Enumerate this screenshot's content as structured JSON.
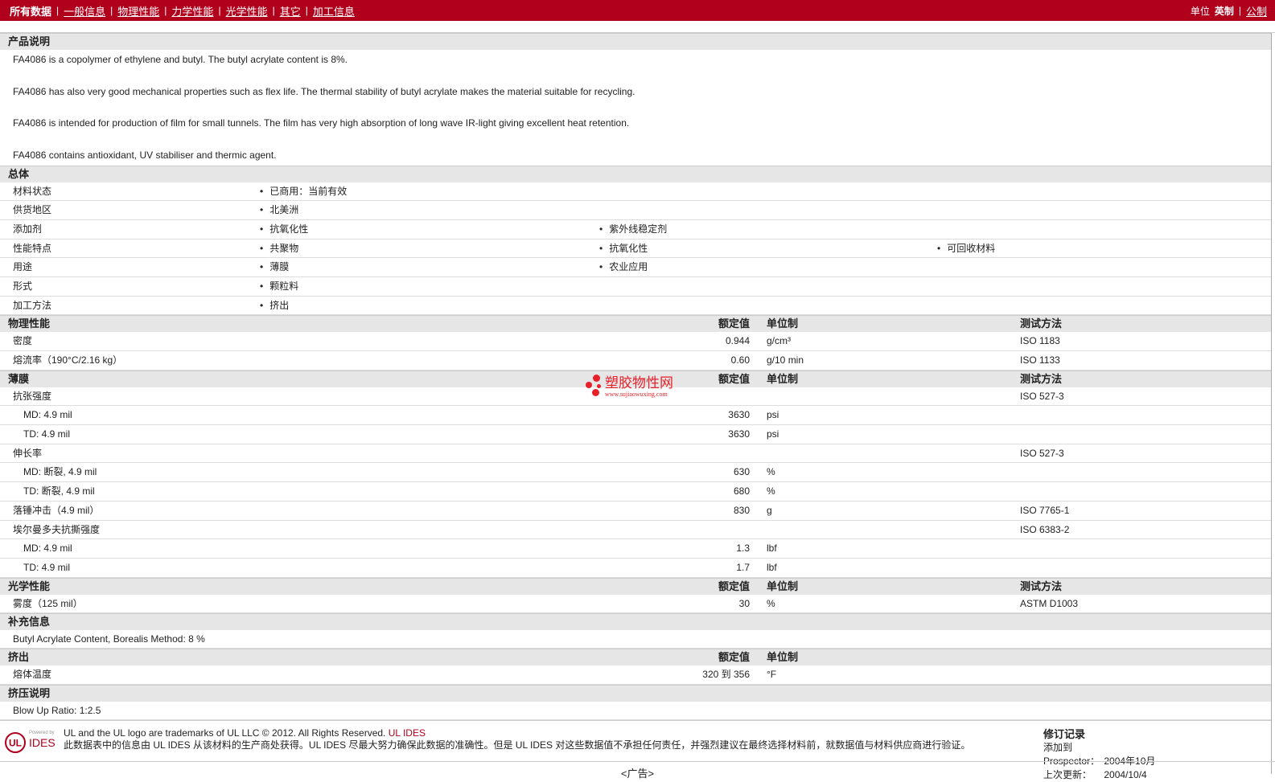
{
  "nav": {
    "items": [
      "所有数据",
      "一般信息",
      "物理性能",
      "力学性能",
      "光学性能",
      "其它",
      "加工信息"
    ],
    "units_label": "单位",
    "unit_english": "英制",
    "unit_metric": "公制"
  },
  "description": {
    "title": "产品说明",
    "paragraphs": [
      "FA4086 is a copolymer of ethylene and butyl. The butyl acrylate content is 8%.",
      "FA4086 has also very good mechanical properties such as flex life. The thermal stability of butyl acrylate makes the material suitable for recycling.",
      "FA4086 is intended for production of film for small tunnels. The film has very high absorption of long wave IR-light giving excellent heat retention.",
      "FA4086 contains antioxidant, UV stabiliser and thermic agent."
    ]
  },
  "general": {
    "title": "总体",
    "rows": [
      {
        "label": "材料状态",
        "values": [
          "已商用：当前有效"
        ]
      },
      {
        "label": "供货地区",
        "values": [
          "北美洲"
        ]
      },
      {
        "label": "添加剂",
        "values": [
          "抗氧化性",
          "紫外线稳定剂"
        ]
      },
      {
        "label": "性能特点",
        "values": [
          "共聚物",
          "抗氧化性",
          "可回收材料"
        ]
      },
      {
        "label": "用途",
        "values": [
          "薄膜",
          "农业应用"
        ]
      },
      {
        "label": "形式",
        "values": [
          "颗粒料"
        ]
      },
      {
        "label": "加工方法",
        "values": [
          "挤出"
        ]
      }
    ]
  },
  "headers": {
    "value": "额定值",
    "unit": "单位制",
    "test": "测试方法"
  },
  "physical": {
    "title": "物理性能",
    "rows": [
      {
        "label": "密度",
        "value": "0.944",
        "unit": "g/cm³",
        "test": "ISO 1183"
      },
      {
        "label": "熔流率（190°C/2.16 kg）",
        "value": "0.60",
        "unit": "g/10 min",
        "test": "ISO 1133"
      }
    ]
  },
  "film": {
    "title": "薄膜",
    "rows": [
      {
        "label": "抗张强度",
        "value": "",
        "unit": "",
        "test": "ISO 527-3",
        "sub": false
      },
      {
        "label": "MD: 4.9 mil",
        "value": "3630",
        "unit": "psi",
        "test": "",
        "sub": true
      },
      {
        "label": "TD: 4.9 mil",
        "value": "3630",
        "unit": "psi",
        "test": "",
        "sub": true
      },
      {
        "label": "伸长率",
        "value": "",
        "unit": "",
        "test": "ISO 527-3",
        "sub": false
      },
      {
        "label": "MD: 断裂, 4.9 mil",
        "value": "630",
        "unit": "%",
        "test": "",
        "sub": true
      },
      {
        "label": "TD: 断裂, 4.9 mil",
        "value": "680",
        "unit": "%",
        "test": "",
        "sub": true
      },
      {
        "label": "落锤冲击（4.9 mil）",
        "value": "830",
        "unit": "g",
        "test": "ISO 7765-1",
        "sub": false
      },
      {
        "label": "埃尔曼多夫抗撕强度",
        "value": "",
        "unit": "",
        "test": "ISO 6383-2",
        "sub": false
      },
      {
        "label": "MD: 4.9 mil",
        "value": "1.3",
        "unit": "lbf",
        "test": "",
        "sub": true
      },
      {
        "label": "TD: 4.9 mil",
        "value": "1.7",
        "unit": "lbf",
        "test": "",
        "sub": true
      }
    ]
  },
  "optical": {
    "title": "光学性能",
    "rows": [
      {
        "label": "雾度（125 mil）",
        "value": "30",
        "unit": "%",
        "test": "ASTM D1003"
      }
    ]
  },
  "supplement": {
    "title": "补充信息",
    "text": "Butyl Acrylate Content, Borealis Method: 8 %"
  },
  "extrusion": {
    "title": "挤出",
    "rows": [
      {
        "label": "熔体温度",
        "value": "320 到  356",
        "unit": "°F"
      }
    ]
  },
  "extrusion_notes": {
    "title": "挤压说明",
    "text": "Blow Up Ratio: 1:2.5"
  },
  "footer": {
    "trademark": "UL and the UL logo are trademarks of UL LLC © 2012. All Rights Reserved.",
    "ul_ides": "UL IDES",
    "disclaimer": "此数据表中的信息由  UL IDES 从该材料的生产商处获得。UL IDES 尽最大努力确保此数据的准确性。但是  UL IDES 对这些数据值不承担任何责任，并强烈建议在最终选择材料前，就数据值与材料供应商进行验证。",
    "logo_small": "Powered by",
    "logo_ul": "UL",
    "logo_ides": "IDES",
    "revision_title": "修订记录",
    "added_label": "添加到  Prospector：",
    "added_value": "2004年10月",
    "updated_label": "上次更新：",
    "updated_value": "2004/10/4"
  },
  "ad": "<广告>",
  "watermark": {
    "name": "塑胶物性网",
    "url": "www.sujiaowuxing.com"
  }
}
